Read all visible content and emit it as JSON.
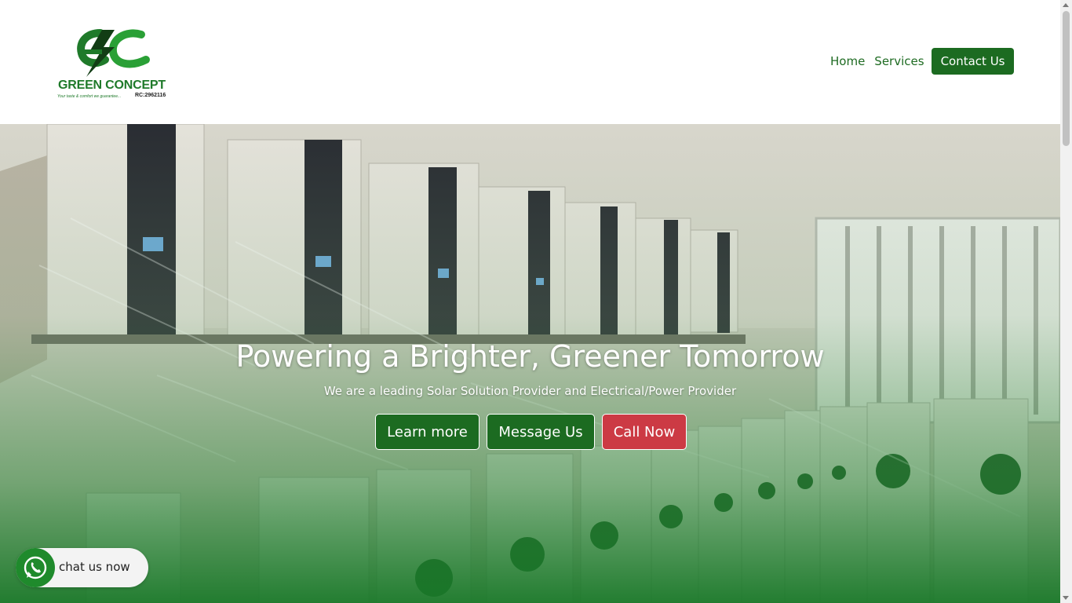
{
  "brand": {
    "name": "GREEN CONCEPT",
    "tagline": "Your taste & comfort we guarantee...",
    "rc": "RC:2962116"
  },
  "nav": {
    "home": "Home",
    "services": "Services",
    "contact": "Contact Us"
  },
  "hero": {
    "title": "Powering a Brighter, Greener Tomorrow",
    "subtitle": "We are a leading Solar Solution Provider and Electrical/Power Provider",
    "buttons": {
      "learn_more": "Learn more",
      "message_us": "Message Us",
      "call_now": "Call Now"
    }
  },
  "chat": {
    "label": "chat us now",
    "icon": "whatsapp-icon"
  },
  "colors": {
    "brand_green": "#1c6b21",
    "call_red": "#cc3a44",
    "whatsapp_green": "#1f8a2c"
  }
}
